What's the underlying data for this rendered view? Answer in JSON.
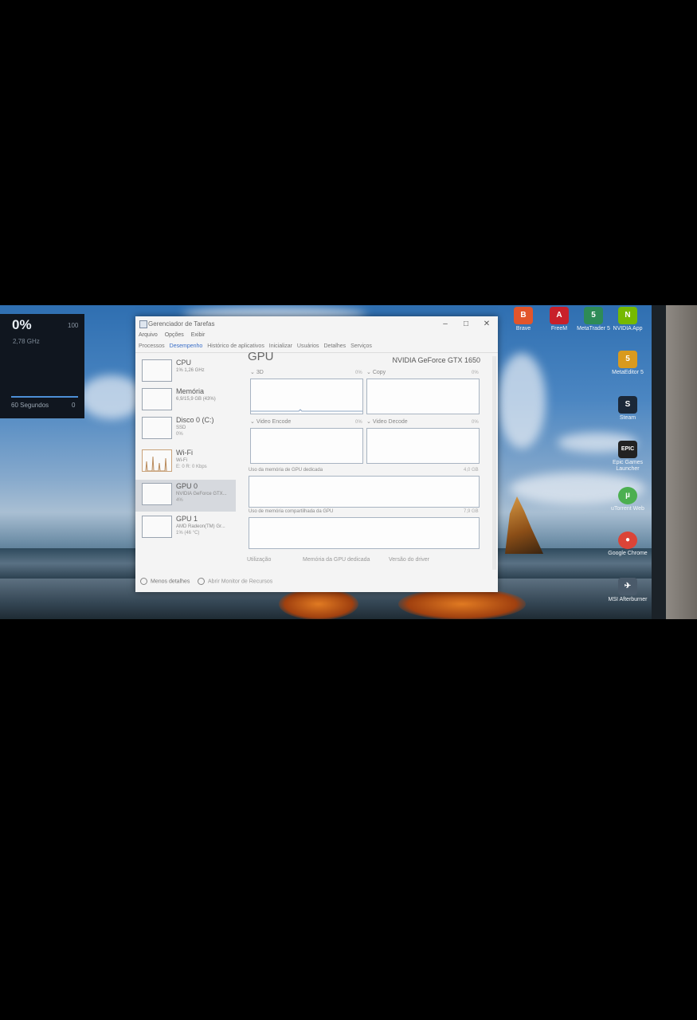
{
  "widget": {
    "percent": "0%",
    "max": "100",
    "freq": "2,78 GHz",
    "footer": "60 Segundos",
    "zero": "0"
  },
  "desktop_icons": [
    {
      "label": "Brave",
      "glyph": "B",
      "color": "#e2552b"
    },
    {
      "label": "FreeM",
      "glyph": "A",
      "color": "#c8202a"
    },
    {
      "label": "MetaTrader 5",
      "glyph": "5",
      "color": "#2e8b57"
    },
    {
      "label": "NVIDIA App",
      "glyph": "N",
      "color": "#76b900"
    },
    {
      "label": "MetaEditor 5",
      "glyph": "5",
      "color": "#d99a1e"
    },
    {
      "label": "Steam",
      "glyph": "S",
      "color": "#1b2838"
    },
    {
      "label": "Epic Games Launcher",
      "glyph": "EPIC",
      "color": "#222"
    },
    {
      "label": "uTorrent Web",
      "glyph": "µ",
      "color": "#4caf50"
    },
    {
      "label": "Google Chrome",
      "glyph": "●",
      "color": "#db4437"
    },
    {
      "label": "MSI Afterburner",
      "glyph": "✈",
      "color": "#4a5a6a"
    }
  ],
  "taskmanager": {
    "title": "Gerenciador de Tarefas",
    "menu": [
      "Arquivo",
      "Opções",
      "Exibir"
    ],
    "tabs": [
      "Processos",
      "Desempenho",
      "Histórico de aplicativos",
      "Inicializar",
      "Usuários",
      "Detalhes",
      "Serviços"
    ],
    "side": [
      {
        "name": "CPU",
        "d1": "1% 1,26 GHz",
        "d2": ""
      },
      {
        "name": "Memória",
        "d1": "6,9/15,9 GB (43%)",
        "d2": ""
      },
      {
        "name": "Disco 0 (C:)",
        "d1": "SSD",
        "d2": "0%"
      },
      {
        "name": "Wi-Fi",
        "d1": "Wi-Fi",
        "d2": "E: 0 R: 0 Kbps"
      },
      {
        "name": "GPU 0",
        "d1": "NVIDIA GeForce GTX...",
        "d2": "4%"
      },
      {
        "name": "GPU 1",
        "d1": "AMD Radeon(TM) Gr...",
        "d2": "1% (46 °C)"
      }
    ],
    "heading": "GPU",
    "model": "NVIDIA GeForce GTX 1650",
    "graphs": {
      "g3d": "3D",
      "copy": "Copy",
      "venc": "Video Encode",
      "vdec": "Video Decode",
      "pct": "0%"
    },
    "dedicated_label": "Uso da memória de GPU dedicada",
    "dedicated_max": "4,0 GB",
    "shared_label": "Uso de memória compartilhada da GPU",
    "shared_max": "7,9 GB",
    "footer": [
      "Utilização",
      "Memória da GPU dedicada",
      "Versão do driver"
    ],
    "less_details": "Menos detalhes",
    "open_monitor": "Abrir Monitor de Recursos"
  }
}
